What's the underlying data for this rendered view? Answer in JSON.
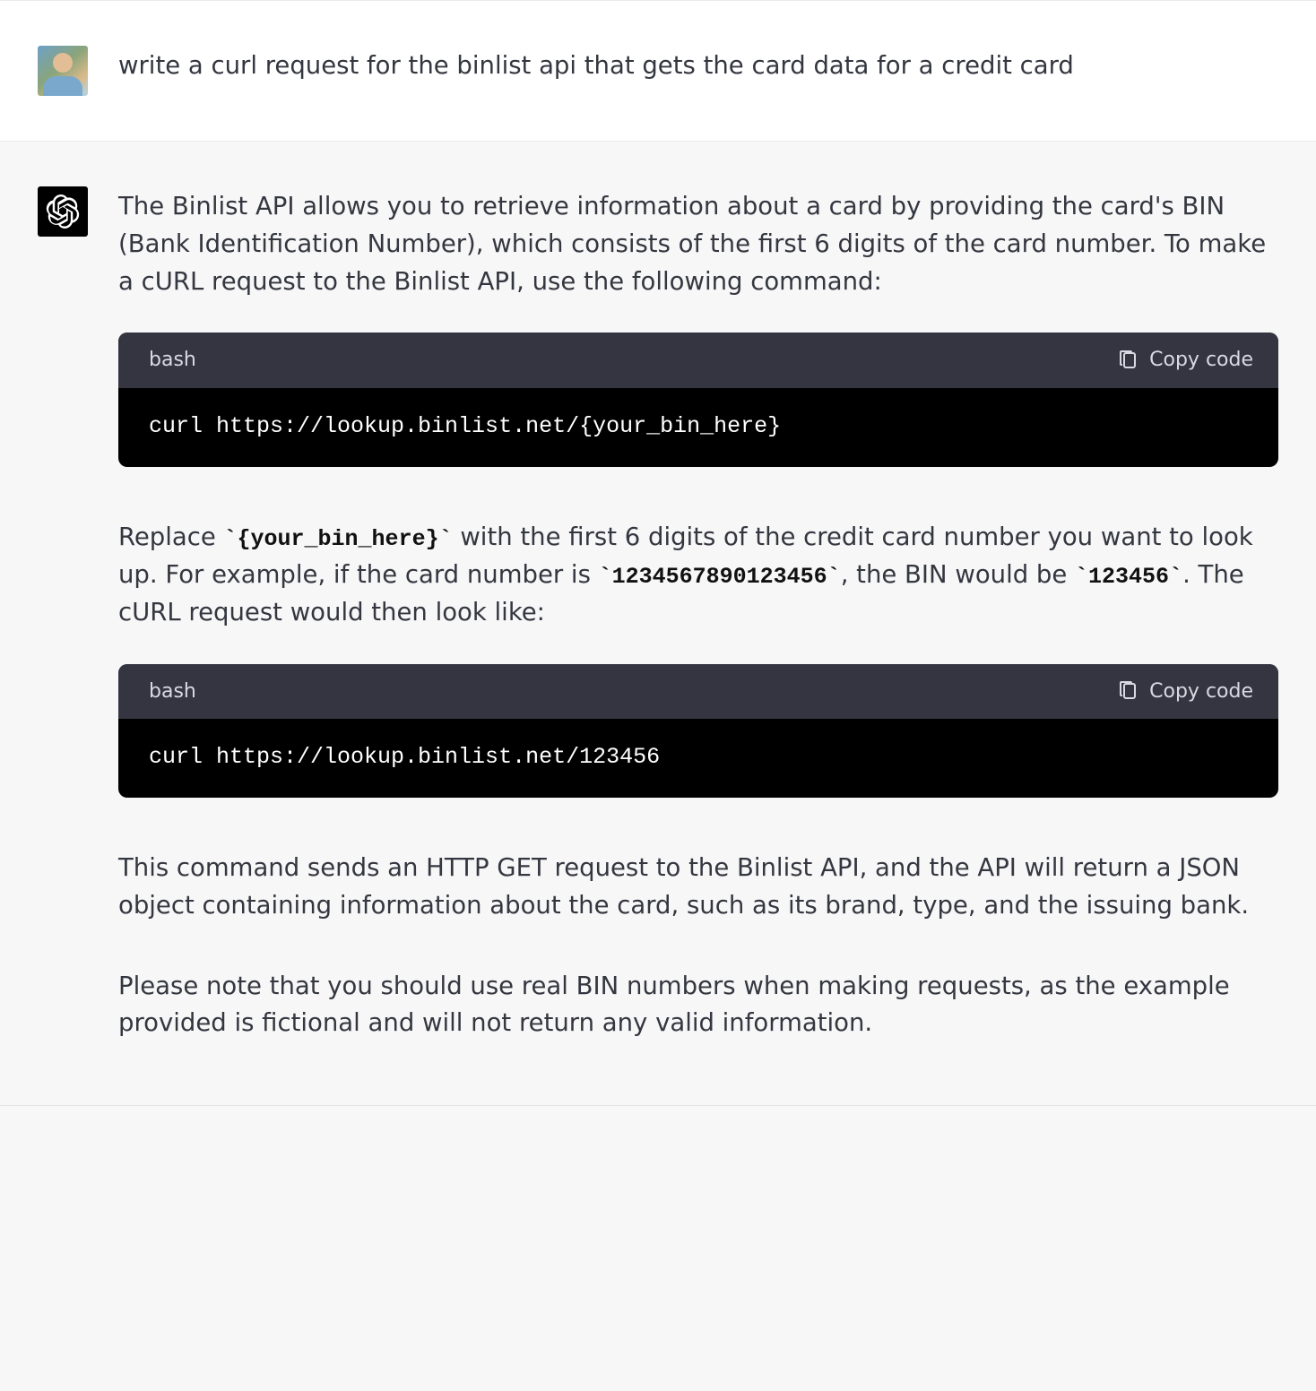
{
  "messages": {
    "user": {
      "text": "write a curl request for the binlist api that gets the card data for a credit card"
    },
    "assistant": {
      "para1": "The Binlist API allows you to retrieve information about a card by providing the card's BIN (Bank Identification Number), which consists of the first 6 digits of the card number. To make a cURL request to the Binlist API, use the following command:",
      "code1": {
        "lang": "bash",
        "copy_label": "Copy code",
        "content": "curl https://lookup.binlist.net/{your_bin_here}"
      },
      "para2_pre": "Replace ",
      "para2_code1": "`{your_bin_here}`",
      "para2_mid1": " with the first 6 digits of the credit card number you want to look up. For example, if the card number is ",
      "para2_code2": "`1234567890123456`",
      "para2_mid2": ", the BIN would be ",
      "para2_code3": "`123456`",
      "para2_post": ". The cURL request would then look like:",
      "code2": {
        "lang": "bash",
        "copy_label": "Copy code",
        "content": "curl https://lookup.binlist.net/123456"
      },
      "para3": "This command sends an HTTP GET request to the Binlist API, and the API will return a JSON object containing information about the card, such as its brand, type, and the issuing bank.",
      "para4": "Please note that you should use real BIN numbers when making requests, as the example provided is fictional and will not return any valid information."
    }
  }
}
